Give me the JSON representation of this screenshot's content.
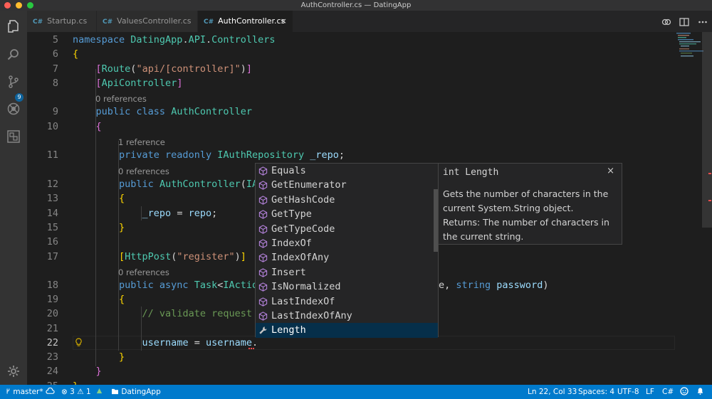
{
  "window": {
    "title": "AuthController.cs — DatingApp"
  },
  "activity_bar": {
    "scm_badge": "9"
  },
  "tabs": [
    {
      "label": "Startup.cs",
      "lang": "C#"
    },
    {
      "label": "ValuesController.cs",
      "lang": "C#"
    },
    {
      "label": "AuthController.cs",
      "lang": "C#",
      "active": true,
      "close": "×"
    }
  ],
  "editor": {
    "lines": [
      {
        "n": "5",
        "tokens": [
          [
            "kw",
            "namespace "
          ],
          [
            "ty",
            "DatingApp"
          ],
          [
            "pl",
            "."
          ],
          [
            "ty",
            "API"
          ],
          [
            "pl",
            "."
          ],
          [
            "ty",
            "Controllers"
          ]
        ]
      },
      {
        "n": "6",
        "tokens": [
          [
            "br",
            "{"
          ]
        ]
      },
      {
        "n": "7",
        "tokens": [
          [
            "pl",
            "    "
          ],
          [
            "br2",
            "["
          ],
          [
            "ty",
            "Route"
          ],
          [
            "pl",
            "("
          ],
          [
            "str",
            "\"api/[controller]\""
          ],
          [
            "pl",
            ")"
          ],
          [
            "br2",
            "]"
          ]
        ]
      },
      {
        "n": "8",
        "tokens": [
          [
            "pl",
            "    "
          ],
          [
            "br2",
            "["
          ],
          [
            "ty",
            "ApiController"
          ],
          [
            "br2",
            "]"
          ]
        ]
      },
      {
        "n": "9",
        "tokens": [
          [
            "pl",
            "    "
          ],
          [
            "kw",
            "public class "
          ],
          [
            "ty",
            "AuthController"
          ]
        ]
      },
      {
        "n": "10",
        "tokens": [
          [
            "pl",
            "    "
          ],
          [
            "br2",
            "{"
          ]
        ]
      },
      {
        "n": "11",
        "tokens": [
          [
            "pl",
            "        "
          ],
          [
            "kw",
            "private readonly "
          ],
          [
            "ty",
            "IAuthRepository "
          ],
          [
            "id",
            "_repo"
          ],
          [
            "pl",
            ";"
          ]
        ]
      },
      {
        "n": "12",
        "tokens": [
          [
            "pl",
            "        "
          ],
          [
            "kw",
            "public "
          ],
          [
            "ty",
            "AuthController"
          ],
          [
            "pl",
            "("
          ],
          [
            "ty",
            "IA"
          ]
        ]
      },
      {
        "n": "13",
        "tokens": [
          [
            "pl",
            "        "
          ],
          [
            "br",
            "{"
          ]
        ]
      },
      {
        "n": "14",
        "tokens": [
          [
            "pl",
            "            "
          ],
          [
            "id",
            "_repo"
          ],
          [
            "pl",
            " = "
          ],
          [
            "id",
            "repo"
          ],
          [
            "pl",
            ";"
          ]
        ]
      },
      {
        "n": "15",
        "tokens": [
          [
            "pl",
            "        "
          ],
          [
            "br",
            "}"
          ]
        ]
      },
      {
        "n": "16",
        "tokens": []
      },
      {
        "n": "17",
        "tokens": [
          [
            "pl",
            "        "
          ],
          [
            "br",
            "["
          ],
          [
            "ty",
            "HttpPost"
          ],
          [
            "pl",
            "("
          ],
          [
            "str",
            "\"register\""
          ],
          [
            "pl",
            ")"
          ],
          [
            "br",
            "]"
          ]
        ]
      },
      {
        "n": "18",
        "tokens": [
          [
            "pl",
            "        "
          ],
          [
            "kw",
            "public async "
          ],
          [
            "ty",
            "Task"
          ],
          [
            "pl",
            "<"
          ],
          [
            "ty",
            "IActio"
          ]
        ]
      },
      {
        "n": "19",
        "tokens": [
          [
            "pl",
            "        "
          ],
          [
            "br",
            "{"
          ]
        ]
      },
      {
        "n": "20",
        "tokens": [
          [
            "pl",
            "            "
          ],
          [
            "cm",
            "// validate request"
          ]
        ]
      },
      {
        "n": "21",
        "tokens": []
      },
      {
        "n": "22",
        "tokens": [
          [
            "pl",
            "            "
          ],
          [
            "id",
            "username"
          ],
          [
            "pl",
            " = "
          ],
          [
            "id",
            "username"
          ],
          [
            "pl",
            "."
          ]
        ]
      },
      {
        "n": "23",
        "tokens": [
          [
            "pl",
            "        "
          ],
          [
            "br",
            "}"
          ]
        ]
      },
      {
        "n": "24",
        "tokens": [
          [
            "pl",
            "    "
          ],
          [
            "br2",
            "}"
          ]
        ]
      },
      {
        "n": "25",
        "tokens": [
          [
            "br",
            "}"
          ]
        ]
      }
    ],
    "line18_tail": [
      [
        "pl",
        "e, "
      ],
      [
        "kw",
        "string "
      ],
      [
        "id",
        "password"
      ],
      [
        "pl",
        ")"
      ]
    ],
    "code_lens": [
      {
        "text": "0 references",
        "before": "9"
      },
      {
        "text": "1 reference",
        "before": "11"
      },
      {
        "text": "0 references",
        "before": "12"
      },
      {
        "text": "0 references",
        "before": "18"
      }
    ]
  },
  "suggestions": {
    "items": [
      {
        "label": "Equals",
        "kind": "method"
      },
      {
        "label": "GetEnumerator",
        "kind": "method"
      },
      {
        "label": "GetHashCode",
        "kind": "method"
      },
      {
        "label": "GetType",
        "kind": "method"
      },
      {
        "label": "GetTypeCode",
        "kind": "method"
      },
      {
        "label": "IndexOf",
        "kind": "method"
      },
      {
        "label": "IndexOfAny",
        "kind": "method"
      },
      {
        "label": "Insert",
        "kind": "method"
      },
      {
        "label": "IsNormalized",
        "kind": "method"
      },
      {
        "label": "LastIndexOf",
        "kind": "method"
      },
      {
        "label": "LastIndexOfAny",
        "kind": "method"
      },
      {
        "label": "Length",
        "kind": "property",
        "selected": true
      }
    ]
  },
  "details": {
    "signature": "int Length",
    "close": "×",
    "description": "Gets the number of characters in the current System.String object.",
    "returns": "Returns: The number of characters in the current string."
  },
  "status_bar": {
    "branch": "master*",
    "errors": "3",
    "warnings": "1",
    "project": "DatingApp",
    "cursor": "Ln 22, Col 33",
    "spaces": "Spaces: 4",
    "encoding": "UTF-8",
    "eol": "LF",
    "language": "C#"
  },
  "colors": {
    "accent": "#007acc",
    "selection": "#062f4a",
    "method_icon": "#b180d7"
  }
}
